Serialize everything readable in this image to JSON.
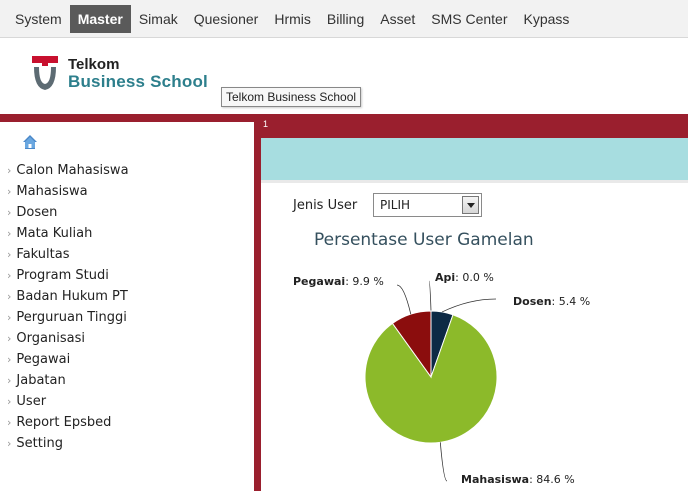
{
  "nav": {
    "items": [
      "System",
      "Master",
      "Simak",
      "Quesioner",
      "Hrmis",
      "Billing",
      "Asset",
      "SMS Center",
      "Kypass"
    ],
    "active": "Master"
  },
  "logo": {
    "line1": "Telkom",
    "line2": "Business School"
  },
  "tooltip": "Telkom Business School",
  "sidebar": {
    "home_icon": "home-icon",
    "items": [
      "Calon Mahasiswa",
      "Mahasiswa",
      "Dosen",
      "Mata Kuliah",
      "Fakultas",
      "Program Studi",
      "Badan Hukum PT",
      "Perguruan Tinggi",
      "Organisasi",
      "Pegawai",
      "Jabatan",
      "User",
      "Report Epsbed",
      "Setting"
    ]
  },
  "main": {
    "top_marker": "1"
  },
  "filter": {
    "label": "Jenis User",
    "selected": "PILIH"
  },
  "chart_data": {
    "type": "pie",
    "title": "Persentase User Gamelan",
    "slices": [
      {
        "name": "Api",
        "value": 0.0,
        "label": "0.0 %",
        "color": "#1a3d5c"
      },
      {
        "name": "Dosen",
        "value": 5.4,
        "label": "5.4 %",
        "color": "#0d2a45"
      },
      {
        "name": "Mahasiswa",
        "value": 84.6,
        "label": "84.6 %",
        "color": "#8cba2a"
      },
      {
        "name": "Pegawai",
        "value": 9.9,
        "label": "9.9 %",
        "color": "#8b0d0d"
      }
    ]
  },
  "colors": {
    "brand_red": "#9a1f2e",
    "teal_band": "#a7dde0",
    "logo_teal": "#2d7f8c"
  }
}
